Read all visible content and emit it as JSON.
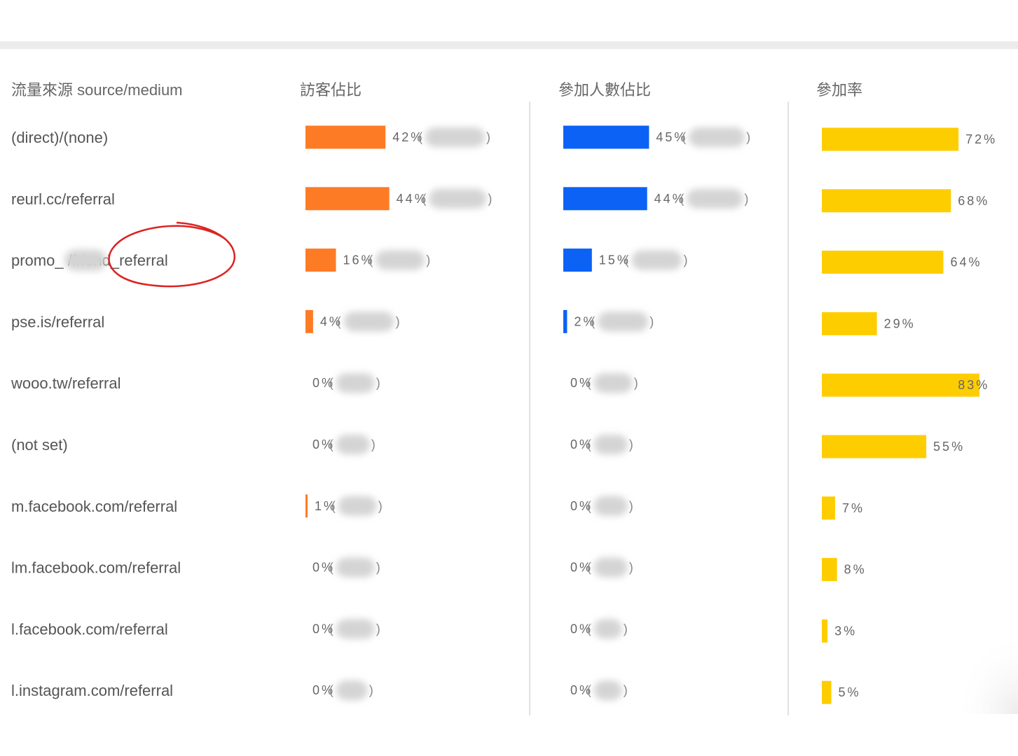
{
  "chart_data": {
    "type": "bar",
    "headers": {
      "source": "流量來源 source/medium",
      "visitors": "訪客佔比",
      "participants": "參加人數佔比",
      "rate": "參加率"
    },
    "categories": [
      "(direct)/(none)",
      "reurl.cc/referral",
      "promo_ /friend_referral",
      "pse.is/referral",
      "wooo.tw/referral",
      "(not set)",
      "m.facebook.com/referral",
      "lm.facebook.com/referral",
      "l.facebook.com/referral",
      "l.instagram.com/referral"
    ],
    "series": [
      {
        "key": "visitors",
        "color": "#fe7b26",
        "values": [
          42,
          44,
          16,
          4,
          0,
          0,
          1,
          0,
          0,
          0
        ],
        "labels": [
          "42%",
          "44%",
          "16%",
          "4%",
          "0%",
          "0%",
          "1%",
          "0%",
          "0%",
          "0%"
        ]
      },
      {
        "key": "participants",
        "color": "#0b62f5",
        "values": [
          45,
          44,
          15,
          2,
          0,
          0,
          0,
          0,
          0,
          0
        ],
        "labels": [
          "45%",
          "44%",
          "15%",
          "2%",
          "0%",
          "0%",
          "0%",
          "0%",
          "0%",
          "0%"
        ]
      },
      {
        "key": "rate",
        "color": "#fecd00",
        "values": [
          72,
          68,
          64,
          29,
          83,
          55,
          7,
          8,
          3,
          5
        ],
        "labels": [
          "72%",
          "68%",
          "64%",
          "29%",
          "83%",
          "55%",
          "7%",
          "8%",
          "3%",
          "5%"
        ]
      }
    ],
    "paren_open": "(",
    "paren_close": ")",
    "value_axis": [
      0,
      100
    ],
    "grid": false,
    "highlight": {
      "row": 2,
      "text": "/friend_referral",
      "color": "#dd2222"
    }
  }
}
